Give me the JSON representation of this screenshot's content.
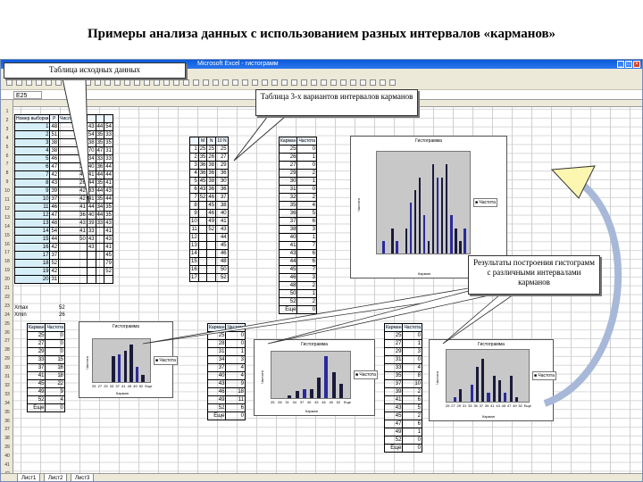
{
  "slide": {
    "title": "Примеры анализа данных с использованием разных интервалов «карманов»"
  },
  "excel": {
    "window_title": "Microsoft Excel - гистограмм",
    "name_box": "E25",
    "sheet_tabs": [
      "Лист1",
      "Лист2",
      "Лист3"
    ]
  },
  "callouts": {
    "source_table": "Таблица исходных данных",
    "bins_table": "Таблица 3-х вариантов интервалов карманов",
    "results": "Результаты построения гистограмм с различными интервалами карманов"
  },
  "table_main": {
    "headers": [
      "Номер выборки",
      "Р",
      "Число очков",
      "",
      "",
      ""
    ],
    "rows": [
      [
        "1",
        "48",
        "44",
        "43",
        "44",
        "54"
      ],
      [
        "2",
        "51",
        "38",
        "54",
        "35",
        "33"
      ],
      [
        "3",
        "38",
        "26",
        "38",
        "35",
        "35"
      ],
      [
        "4",
        "38",
        "39",
        "70",
        "47",
        "31"
      ],
      [
        "5",
        "46",
        "43",
        "34",
        "33",
        "33"
      ],
      [
        "6",
        "47",
        "38",
        "40",
        "36",
        "44"
      ],
      [
        "7",
        "42",
        "43",
        "41",
        "44",
        "44"
      ],
      [
        "8",
        "43",
        "26",
        "44",
        "35",
        "41"
      ],
      [
        "9",
        "39",
        "42",
        "33",
        "44",
        "43"
      ],
      [
        "10",
        "37",
        "42",
        "41",
        "35",
        "44"
      ],
      [
        "11",
        "46",
        "41",
        "44",
        "34",
        "35"
      ],
      [
        "12",
        "47",
        "36",
        "40",
        "44",
        "35"
      ],
      [
        "13",
        "48",
        "43",
        "39",
        "33",
        "43"
      ],
      [
        "14",
        "54",
        "41",
        "33",
        "",
        "41"
      ],
      [
        "15",
        "44",
        "50",
        "43",
        "",
        "43"
      ],
      [
        "16",
        "42",
        "",
        "43",
        "",
        "41"
      ],
      [
        "17",
        "37",
        "",
        "",
        "",
        "45"
      ],
      [
        "18",
        "52",
        "",
        "",
        "",
        "79"
      ],
      [
        "19",
        "42",
        "",
        "",
        "",
        "52"
      ],
      [
        "20",
        "31",
        "",
        "",
        "",
        ""
      ]
    ]
  },
  "stats": {
    "xmax_label": "Xmax",
    "xmax_value": "52",
    "xmin_label": "Xmin",
    "xmin_value": "26"
  },
  "bins_table": {
    "headers": [
      "M",
      "N",
      "10 N"
    ],
    "rows": [
      [
        "1",
        "25",
        "25",
        "25"
      ],
      [
        "2",
        "35",
        "26",
        "27"
      ],
      [
        "3",
        "36",
        "38",
        "29"
      ],
      [
        "4",
        "36",
        "36",
        "36"
      ],
      [
        "5",
        "45",
        "38",
        "30"
      ],
      [
        "6",
        "43",
        "36",
        "36"
      ],
      [
        "7",
        "52",
        "46",
        "37"
      ],
      [
        "8",
        "",
        "45",
        "38"
      ],
      [
        "9",
        "",
        "46",
        "40"
      ],
      [
        "10",
        "",
        "49",
        "41"
      ],
      [
        "11",
        "",
        "52",
        "43"
      ],
      [
        "12",
        "",
        "",
        "44"
      ],
      [
        "13",
        "",
        "",
        "45"
      ],
      [
        "14",
        "",
        "",
        "46"
      ],
      [
        "15",
        "",
        "",
        "48"
      ],
      [
        "16",
        "",
        "",
        "50"
      ],
      [
        "17",
        "",
        "",
        "52"
      ]
    ]
  },
  "freq_table": {
    "headers": [
      "Карман",
      "Частота"
    ],
    "rows": [
      [
        "25",
        "0"
      ],
      [
        "26",
        "1"
      ],
      [
        "27",
        "0"
      ],
      [
        "29",
        "2"
      ],
      [
        "30",
        "1"
      ],
      [
        "31",
        "0"
      ],
      [
        "32",
        "2"
      ],
      [
        "35",
        "4"
      ],
      [
        "36",
        "5"
      ],
      [
        "37",
        "6"
      ],
      [
        "38",
        "3"
      ],
      [
        "40",
        "1"
      ],
      [
        "41",
        "7"
      ],
      [
        "43",
        "6"
      ],
      [
        "44",
        "6"
      ],
      [
        "45",
        "7"
      ],
      [
        "46",
        "3"
      ],
      [
        "48",
        "2"
      ],
      [
        "50",
        "1"
      ],
      [
        "52",
        "2"
      ],
      [
        "Еще",
        "0"
      ]
    ]
  },
  "bottom_tables": [
    {
      "headers": [
        "Карман",
        "Частота"
      ],
      "rows": [
        [
          "25",
          "0"
        ],
        [
          "27",
          "0"
        ],
        [
          "29",
          "0"
        ],
        [
          "33",
          "15"
        ],
        [
          "37",
          "16"
        ],
        [
          "41",
          "18"
        ],
        [
          "45",
          "22"
        ],
        [
          "49",
          "9"
        ],
        [
          "52",
          "4"
        ],
        [
          "Еще",
          "0"
        ]
      ]
    },
    {
      "headers": [
        "Карман",
        "Частота"
      ],
      "rows": [
        [
          "25",
          "0"
        ],
        [
          "28",
          "0"
        ],
        [
          "31",
          "1"
        ],
        [
          "34",
          "3"
        ],
        [
          "37",
          "4"
        ],
        [
          "40",
          "4"
        ],
        [
          "43",
          "9"
        ],
        [
          "46",
          "18"
        ],
        [
          "49",
          "11"
        ],
        [
          "52",
          "6"
        ],
        [
          "Еще",
          "0"
        ]
      ]
    },
    {
      "headers": [
        "Карман",
        "Частота"
      ],
      "rows": [
        [
          "25",
          "0"
        ],
        [
          "27",
          "1"
        ],
        [
          "29",
          "3"
        ],
        [
          "31",
          "0"
        ],
        [
          "33",
          "4"
        ],
        [
          "35",
          "8"
        ],
        [
          "37",
          "10"
        ],
        [
          "39",
          "2"
        ],
        [
          "41",
          "6"
        ],
        [
          "43",
          "5"
        ],
        [
          "45",
          "2"
        ],
        [
          "47",
          "6"
        ],
        [
          "49",
          "1"
        ],
        [
          "52",
          "0"
        ],
        [
          "Еще",
          "0"
        ]
      ]
    }
  ],
  "charts": {
    "title": "Гистограмма",
    "legend": "Частота",
    "xlabel": "Карман",
    "ylabel": "Частота"
  },
  "chart_data": [
    {
      "type": "bar",
      "title": "Гистограмма",
      "xlabel": "Карман",
      "ylabel": "Частота",
      "ylim": [
        0,
        8
      ],
      "series": [
        {
          "name": "Частота",
          "values": [
            0,
            1,
            0,
            2,
            1,
            0,
            2,
            4,
            5,
            6,
            3,
            1,
            7,
            6,
            6,
            7,
            3,
            2,
            1,
            2,
            0
          ]
        }
      ]
    },
    {
      "type": "bar",
      "title": "Гистограмма",
      "xlabel": "Карман",
      "ylabel": "Частота",
      "ylim": [
        0,
        25
      ],
      "categories": [
        "25",
        "27",
        "29",
        "33",
        "37",
        "41",
        "45",
        "49",
        "52",
        "Еще"
      ],
      "series": [
        {
          "name": "Частота",
          "values": [
            0,
            0,
            0,
            15,
            16,
            18,
            22,
            9,
            4,
            0
          ]
        }
      ]
    },
    {
      "type": "bar",
      "title": "Гистограмма",
      "xlabel": "Карман",
      "ylabel": "Частота",
      "ylim": [
        0,
        20
      ],
      "categories": [
        "25",
        "28",
        "31",
        "34",
        "37",
        "40",
        "43",
        "46",
        "49",
        "52",
        "Еще"
      ],
      "series": [
        {
          "name": "Частота",
          "values": [
            0,
            0,
            1,
            3,
            4,
            4,
            9,
            18,
            11,
            6,
            0
          ]
        }
      ]
    },
    {
      "type": "bar",
      "title": "Гистограмма",
      "xlabel": "Карман",
      "ylabel": "Частота",
      "ylim": [
        0,
        12
      ],
      "categories": [
        "25",
        "27",
        "29",
        "31",
        "33",
        "35",
        "37",
        "39",
        "41",
        "43",
        "45",
        "47",
        "49",
        "52",
        "Еще"
      ],
      "series": [
        {
          "name": "Частота",
          "values": [
            0,
            1,
            3,
            0,
            4,
            8,
            10,
            2,
            6,
            5,
            2,
            6,
            1,
            0,
            0
          ]
        }
      ]
    }
  ]
}
